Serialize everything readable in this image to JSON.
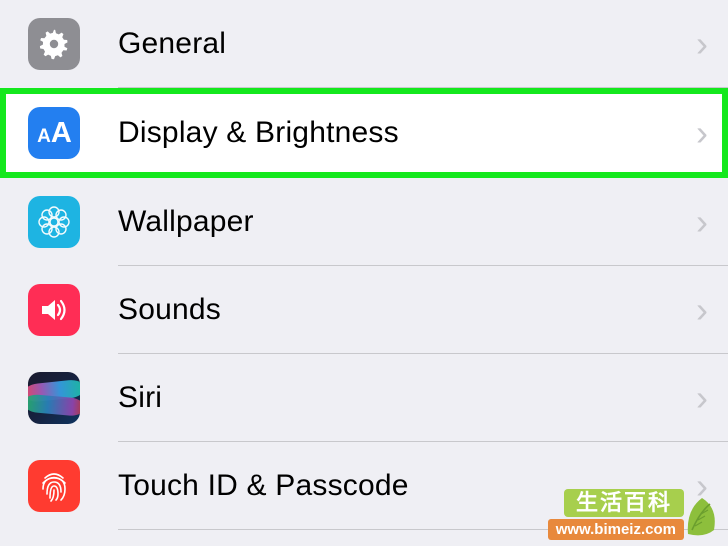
{
  "settings": {
    "items": [
      {
        "key": "general",
        "label": "General",
        "icon": "gear-icon",
        "highlighted": false
      },
      {
        "key": "display",
        "label": "Display & Brightness",
        "icon": "text-size-icon",
        "highlighted": true
      },
      {
        "key": "wallpaper",
        "label": "Wallpaper",
        "icon": "flower-icon",
        "highlighted": false
      },
      {
        "key": "sounds",
        "label": "Sounds",
        "icon": "speaker-icon",
        "highlighted": false
      },
      {
        "key": "siri",
        "label": "Siri",
        "icon": "siri-icon",
        "highlighted": false
      },
      {
        "key": "touchid",
        "label": "Touch ID & Passcode",
        "icon": "fingerprint-icon",
        "highlighted": false
      }
    ]
  },
  "watermark": {
    "title": "生活百科",
    "url": "www.bimeiz.com"
  }
}
